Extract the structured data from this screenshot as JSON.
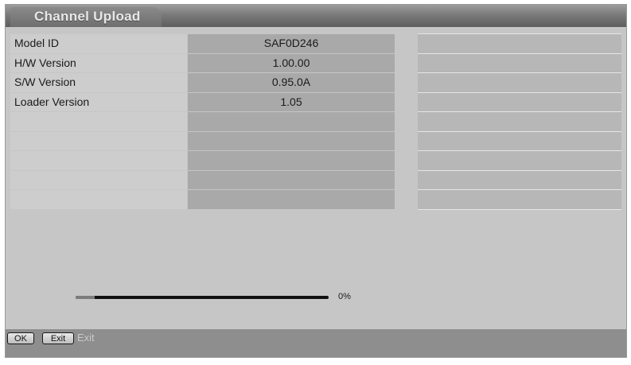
{
  "screen": {
    "title": "Channel Upload"
  },
  "info": {
    "rows": [
      {
        "label": "Model ID",
        "value": "SAF0D246"
      },
      {
        "label": "H/W Version",
        "value": "1.00.00"
      },
      {
        "label": "S/W Version",
        "value": "0.95.0A"
      },
      {
        "label": "Loader Version",
        "value": "1.05"
      },
      {
        "label": "",
        "value": ""
      },
      {
        "label": "",
        "value": ""
      },
      {
        "label": "",
        "value": ""
      },
      {
        "label": "",
        "value": ""
      },
      {
        "label": "",
        "value": ""
      }
    ]
  },
  "progress": {
    "percent": 0,
    "label": "0%"
  },
  "footer": {
    "ok_key": "OK",
    "exit_key": "Exit",
    "exit_label": "Exit"
  },
  "colors": {
    "background": "#c6c6c6",
    "label_cell": "#cdcdcd",
    "value_cell": "#a9a9a9",
    "side_cell": "#b7b7b7",
    "title_bar": "#6e6e6e",
    "footer": "#8e8e8e",
    "progress_track": "#111111"
  }
}
